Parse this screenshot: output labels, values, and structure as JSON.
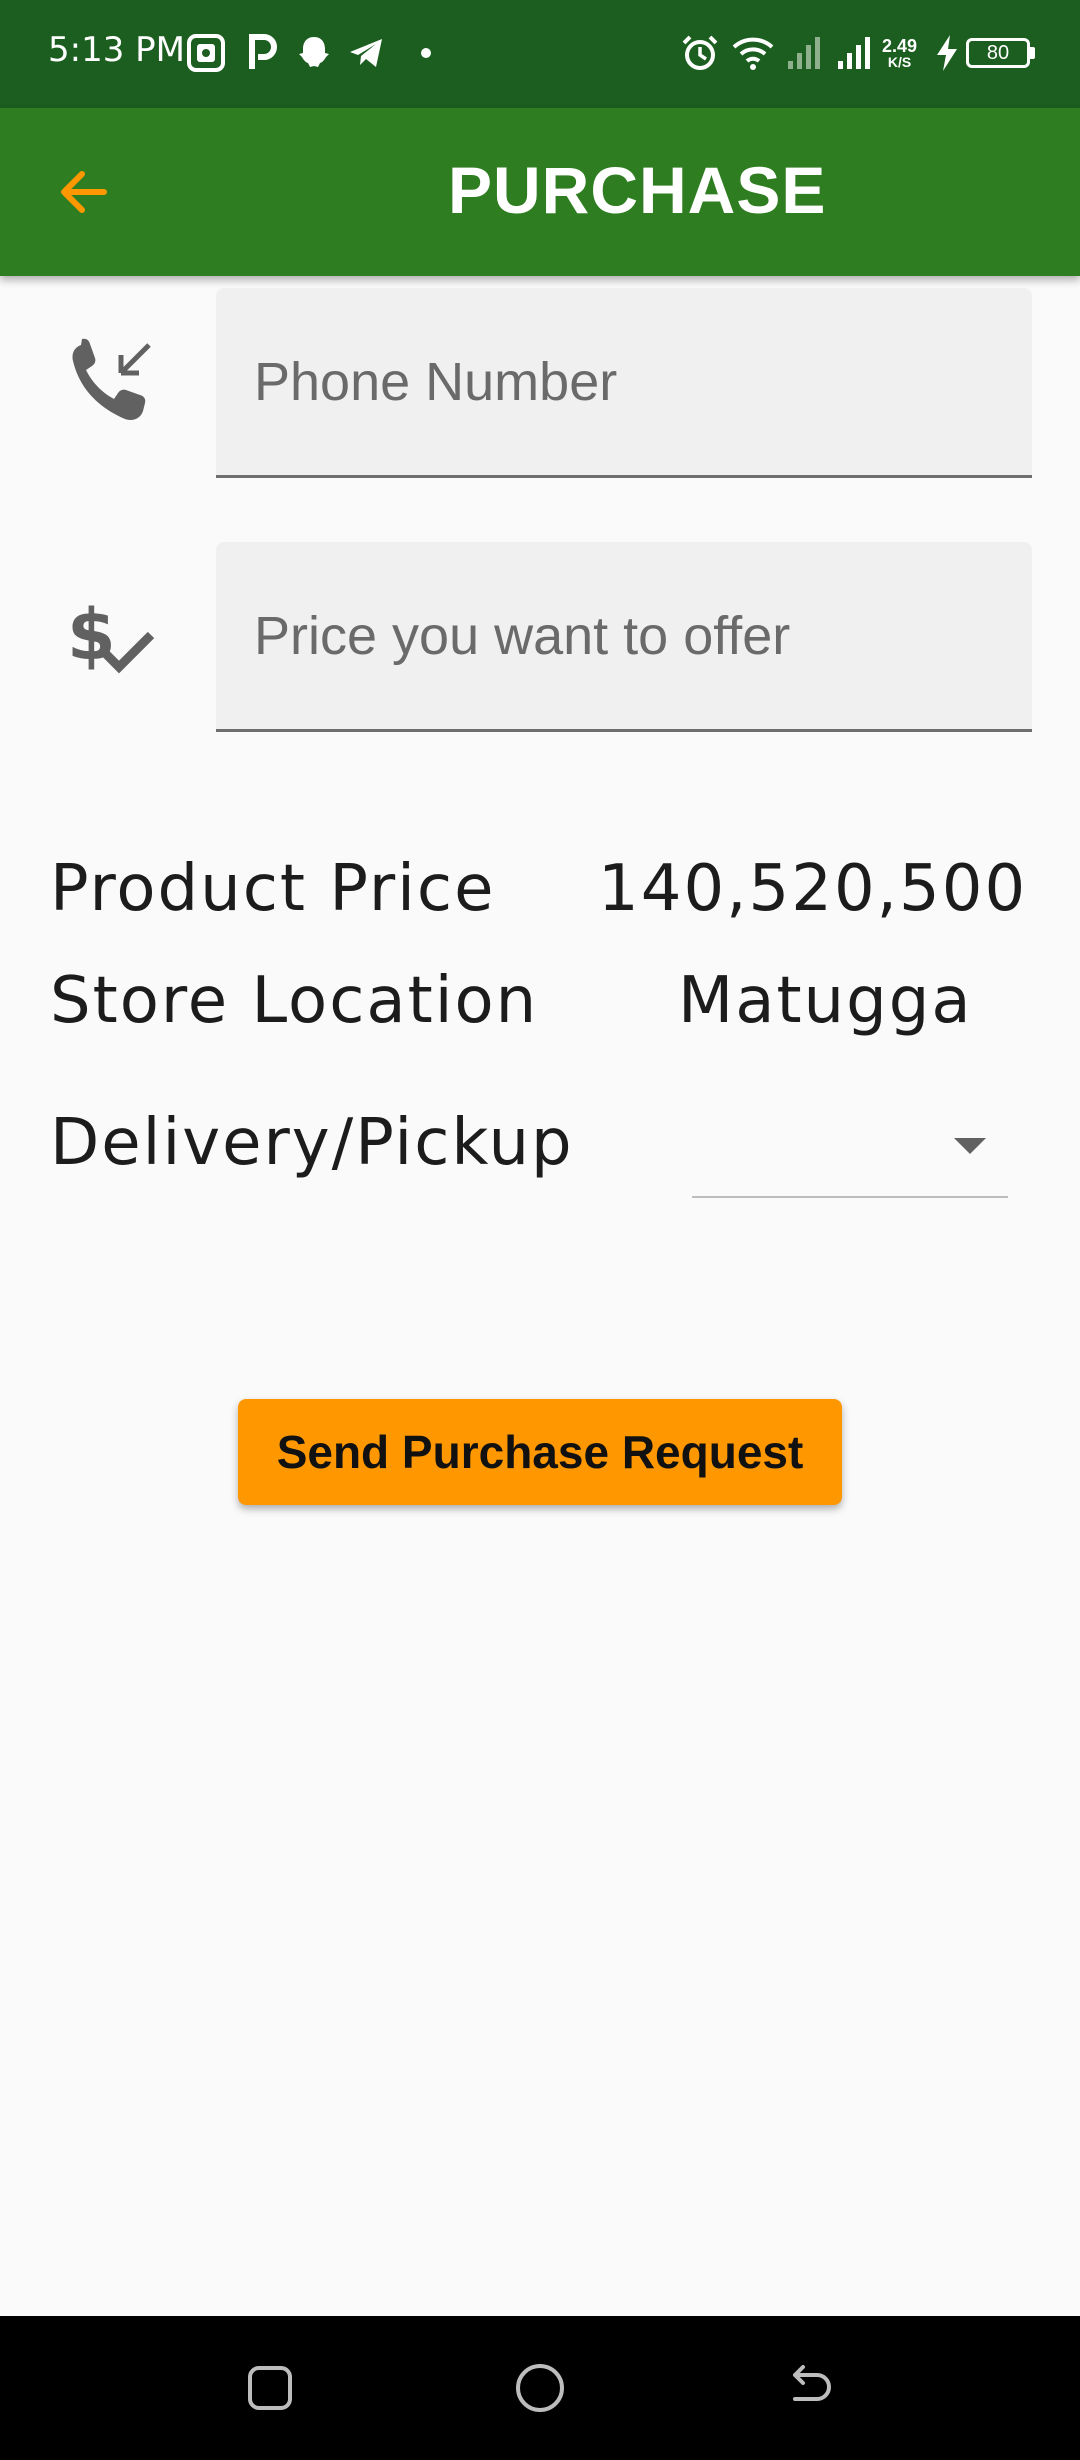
{
  "status_bar": {
    "time": "5:13 PM",
    "left_icons": [
      "gallery-icon",
      "p-icon",
      "snapchat-icon",
      "telegram-icon",
      "dot-icon"
    ],
    "net_speed_value": "2.49",
    "net_speed_unit": "K/S",
    "battery": "80"
  },
  "app_bar": {
    "title": "PURCHASE",
    "back_icon": "arrow-left-icon",
    "accent_color": "#ff9800",
    "bar_color": "#2e7d20"
  },
  "form": {
    "phone": {
      "placeholder": "Phone Number",
      "value": "",
      "icon": "phone-received-icon"
    },
    "price_offer": {
      "placeholder": "Price you want to offer",
      "value": "",
      "icon": "price-check-icon"
    }
  },
  "details": {
    "product_price_label": "Product Price",
    "product_price_value": "140,520,500",
    "store_location_label": "Store Location",
    "store_location_value": "Matugga",
    "delivery_label": "Delivery/Pickup",
    "delivery_selected": ""
  },
  "actions": {
    "send_label": "Send Purchase Request"
  },
  "nav_bar": {
    "items": [
      "recent-apps-icon",
      "home-icon",
      "back-icon"
    ]
  }
}
